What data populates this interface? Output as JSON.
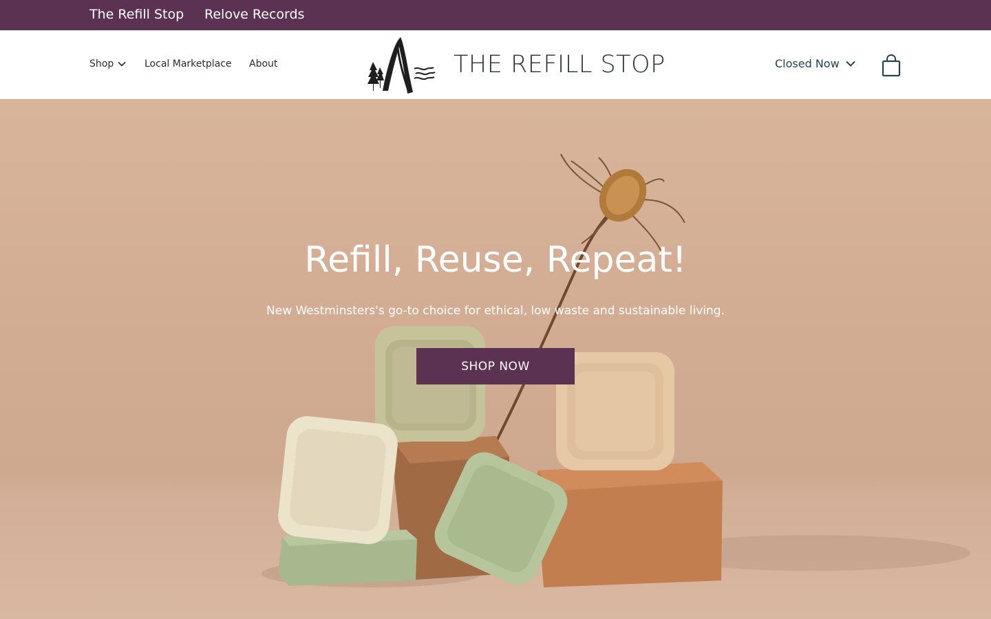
{
  "topbar": {
    "links": [
      "The Refill Stop",
      "Relove Records"
    ],
    "background": "#5b3252"
  },
  "nav": {
    "shop": "Shop",
    "marketplace": "Local Marketplace",
    "about": "About"
  },
  "brand": {
    "name": "THE REFILL STOP",
    "logo_icon": "mountain-trees-logo"
  },
  "header_right": {
    "hours_status": "Closed Now",
    "cart_icon": "shopping-bag-icon"
  },
  "hero": {
    "title": "Refill, Reuse, Repeat!",
    "subtitle": "New Westminsters's go-to choice for ethical, low waste and sustainable living.",
    "cta": "SHOP NOW",
    "accent": "#5b3252"
  }
}
